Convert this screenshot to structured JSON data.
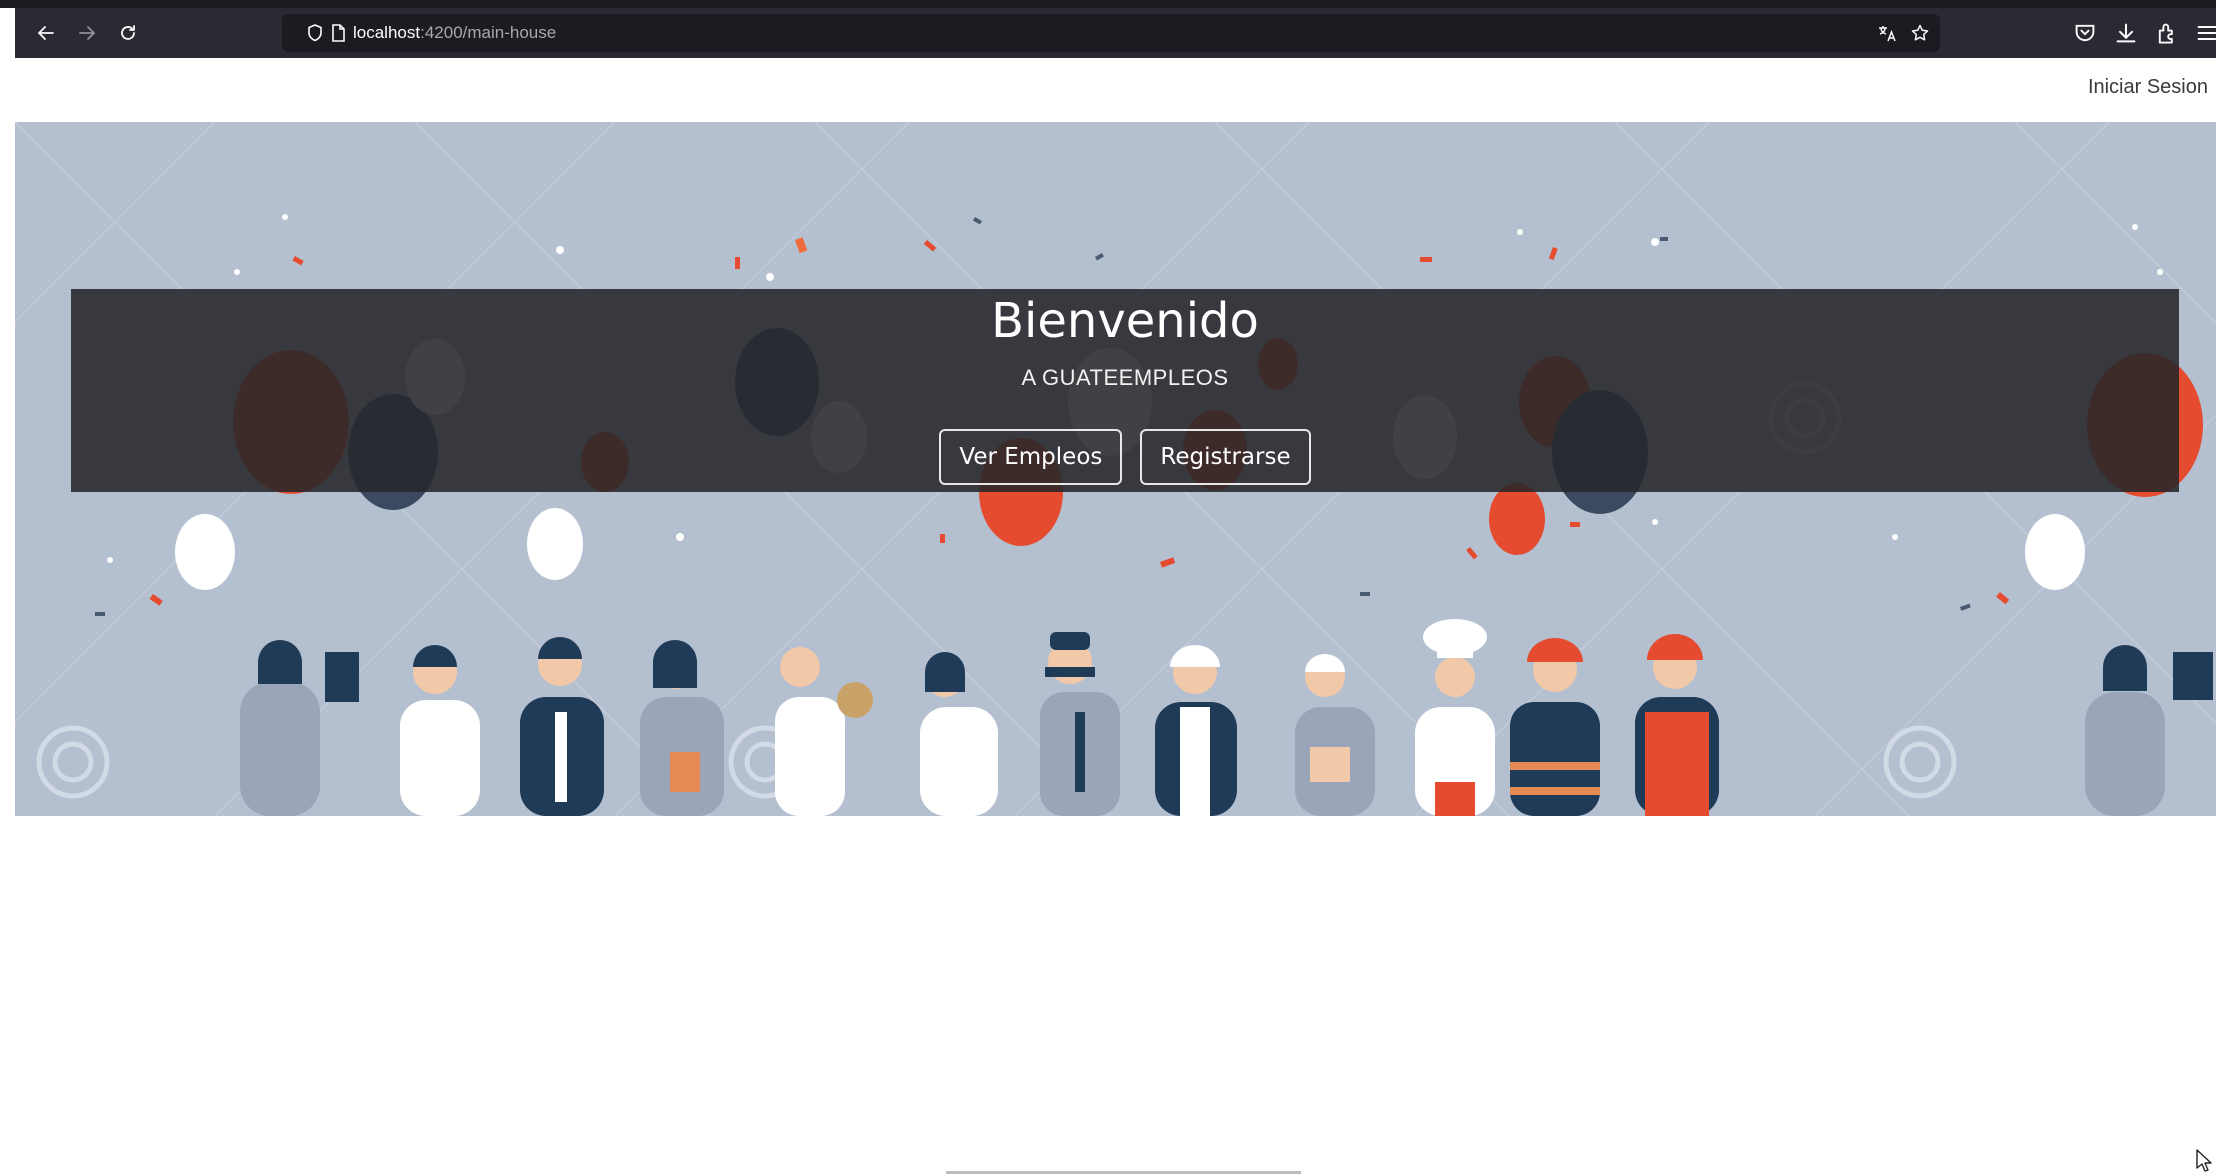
{
  "browser": {
    "url_host": "localhost",
    "url_path": ":4200/main-house",
    "icons": {
      "back": "back-arrow-icon",
      "forward": "forward-arrow-icon",
      "reload": "reload-icon",
      "shield": "shield-icon",
      "page": "page-icon",
      "translate": "translate-icon",
      "bookmark": "star-icon",
      "pocket": "pocket-icon",
      "downloads": "download-icon",
      "extensions": "extensions-icon",
      "menu": "hamburger-menu-icon"
    }
  },
  "header": {
    "login_label": "Iniciar Sesion"
  },
  "hero": {
    "title": "Bienvenido",
    "subtitle": "A GUATEEMPLEOS",
    "buttons": {
      "view_jobs": "Ver Empleos",
      "register": "Registrarse"
    },
    "colors": {
      "background": "#b4bfd0",
      "overlay": "#26272a",
      "accent_red": "#e54b2e",
      "navy": "#1f3b57"
    }
  }
}
